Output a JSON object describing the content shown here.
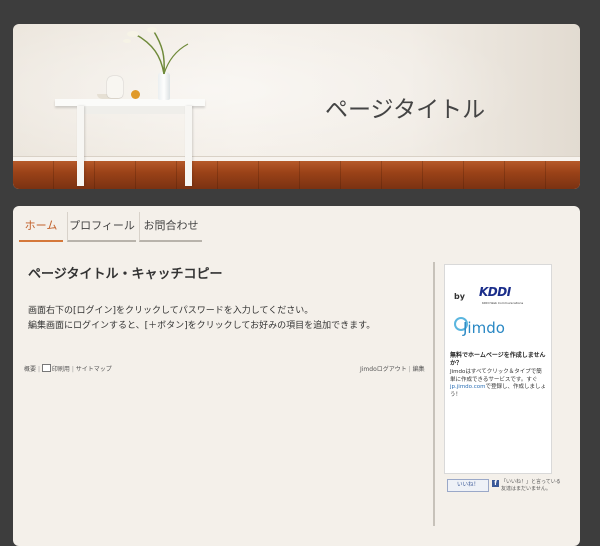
{
  "header": {
    "title": "ページタイトル"
  },
  "nav": {
    "tabs": [
      {
        "label": "ホーム",
        "active": true
      },
      {
        "label": "プロフィール",
        "active": false
      },
      {
        "label": "お問合わせ",
        "active": false
      }
    ]
  },
  "content": {
    "heading": "ページタイトル・キャッチコピー",
    "line1": "画面右下の[ログイン]をクリックしてパスワードを入力してください。",
    "line2": "編集画面にログインすると、[＋ボタン]をクリックしてお好みの項目を追加できます。"
  },
  "footer": {
    "overview": "概要",
    "print": "印刷用",
    "sitemap": "サイトマップ",
    "login": "Jimdoログアウト",
    "edit": "編集",
    "separator": "|"
  },
  "sidebar": {
    "by": "by",
    "kddi": "KDDI",
    "kddi_sub": "KDDI Web Communications",
    "jimdo": "Jimdo",
    "promo_title": "無料でホームページを作成しませんか？",
    "promo_text_1": "Jimdoはすべてクリック＆タイプで簡単に作成できるサービスです。すぐ",
    "promo_link": "jp.jimdo.com",
    "promo_text_2": "で登録し、作成しましょう！",
    "like_button": "いいね！",
    "fb_text": "「いいね！」と言っている友達はまだいません。"
  },
  "colors": {
    "accent": "#d5783a",
    "background": "#3d3d3d",
    "panel": "#f4f0ea"
  }
}
